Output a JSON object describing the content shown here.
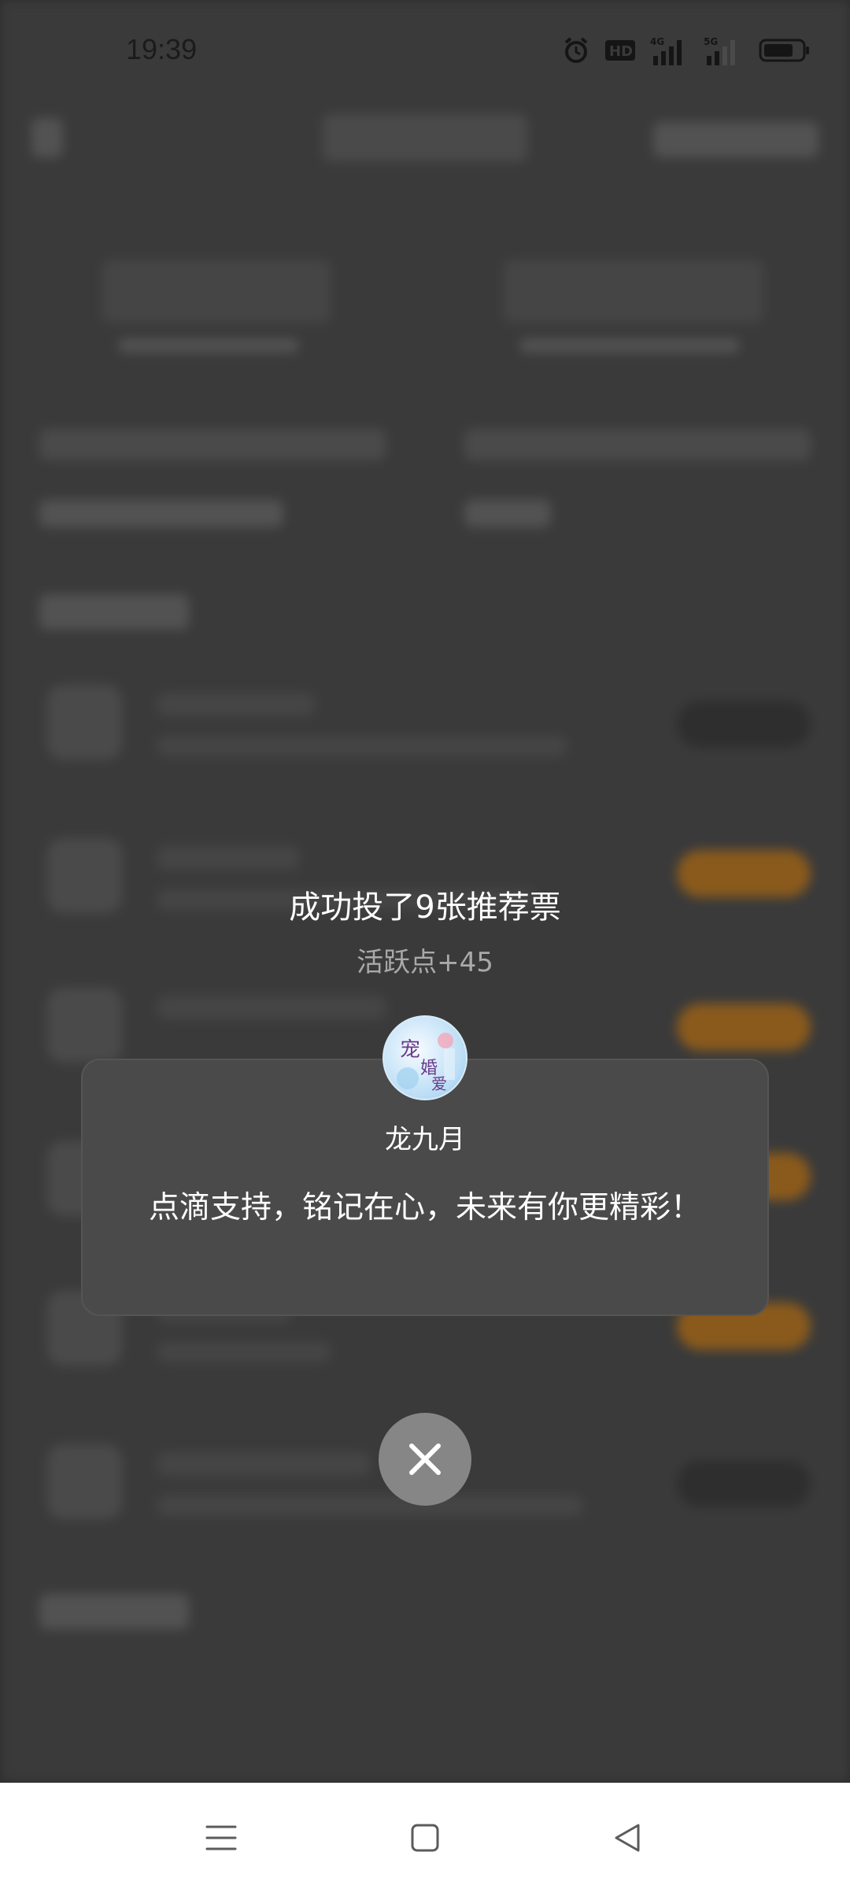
{
  "status_bar": {
    "time": "19:39",
    "icons": [
      "alarm-icon",
      "hd-icon",
      "4g-signal-icon",
      "5g-signal-icon",
      "battery-icon"
    ]
  },
  "dialog": {
    "title": "成功投了9张推荐票",
    "subtitle": "活跃点+45",
    "author": "龙九月",
    "message": "点滴支持，铭记在心，未来有你更精彩！",
    "avatar_text": "宠妻婚爱"
  },
  "nav_bar": {
    "buttons": [
      "menu-icon",
      "home-icon",
      "back-icon"
    ]
  },
  "colors": {
    "overlay": "#3a3a3a",
    "card": "#4a4a4a",
    "close_button": "#868686",
    "subtitle": "#a9a9a9"
  }
}
